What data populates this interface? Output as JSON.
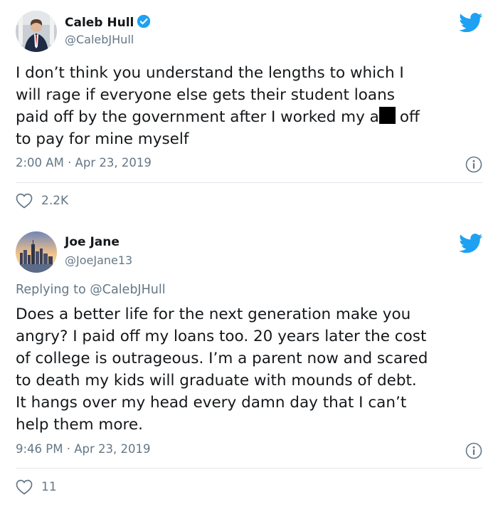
{
  "tweets": [
    {
      "author_name": "Caleb Hull",
      "author_handle": "@CalebJHull",
      "verified": true,
      "body_lines": [
        "I don’t think you understand the lengths to which I",
        "will rage if everyone else gets their student loans",
        "paid off by the government after I worked my a",
        "to pay for mine myself"
      ],
      "redacted_tail": "off",
      "timestamp": "2:00 AM · Apr 23, 2019",
      "likes": "2.2K"
    },
    {
      "author_name": "Joe Jane",
      "author_handle": "@JoeJane13",
      "replying_to_label": "Replying to",
      "replying_to_handle": "@CalebJHull",
      "body_lines": [
        "Does a better life for the next generation make you",
        "angry? I paid off my loans too. 20 years later the cost",
        "of college is outrageous. I’m a parent now and scared",
        "to death my kids will graduate with mounds of debt.",
        "It hangs over my head every damn day that I can’t",
        "help them more."
      ],
      "timestamp": "9:46 PM · Apr 23, 2019",
      "likes": "11"
    }
  ],
  "colors": {
    "twitter_blue": "#1da1f2",
    "secondary_text": "#657786",
    "primary_text": "#14171a"
  },
  "icons": [
    "twitter-bird-icon",
    "verified-badge-icon",
    "info-icon",
    "heart-icon"
  ]
}
